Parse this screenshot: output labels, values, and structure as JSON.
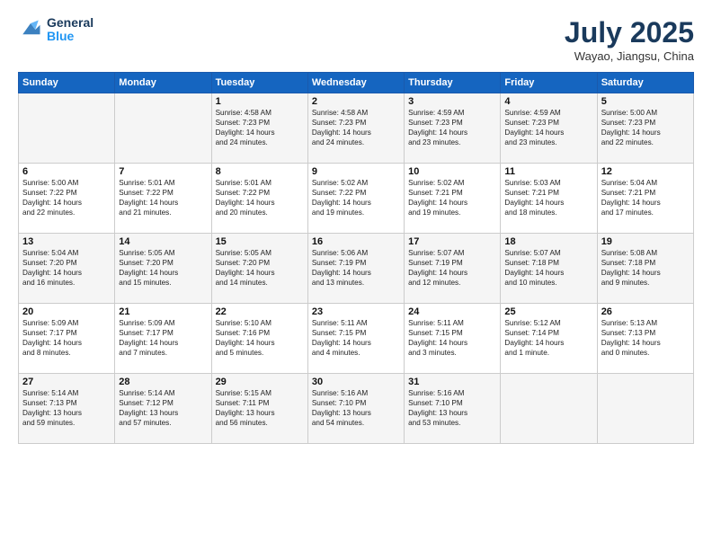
{
  "header": {
    "logo_line1": "General",
    "logo_line2": "Blue",
    "month": "July 2025",
    "location": "Wayao, Jiangsu, China"
  },
  "weekdays": [
    "Sunday",
    "Monday",
    "Tuesday",
    "Wednesday",
    "Thursday",
    "Friday",
    "Saturday"
  ],
  "weeks": [
    [
      {
        "day": "",
        "info": ""
      },
      {
        "day": "",
        "info": ""
      },
      {
        "day": "1",
        "info": "Sunrise: 4:58 AM\nSunset: 7:23 PM\nDaylight: 14 hours\nand 24 minutes."
      },
      {
        "day": "2",
        "info": "Sunrise: 4:58 AM\nSunset: 7:23 PM\nDaylight: 14 hours\nand 24 minutes."
      },
      {
        "day": "3",
        "info": "Sunrise: 4:59 AM\nSunset: 7:23 PM\nDaylight: 14 hours\nand 23 minutes."
      },
      {
        "day": "4",
        "info": "Sunrise: 4:59 AM\nSunset: 7:23 PM\nDaylight: 14 hours\nand 23 minutes."
      },
      {
        "day": "5",
        "info": "Sunrise: 5:00 AM\nSunset: 7:23 PM\nDaylight: 14 hours\nand 22 minutes."
      }
    ],
    [
      {
        "day": "6",
        "info": "Sunrise: 5:00 AM\nSunset: 7:22 PM\nDaylight: 14 hours\nand 22 minutes."
      },
      {
        "day": "7",
        "info": "Sunrise: 5:01 AM\nSunset: 7:22 PM\nDaylight: 14 hours\nand 21 minutes."
      },
      {
        "day": "8",
        "info": "Sunrise: 5:01 AM\nSunset: 7:22 PM\nDaylight: 14 hours\nand 20 minutes."
      },
      {
        "day": "9",
        "info": "Sunrise: 5:02 AM\nSunset: 7:22 PM\nDaylight: 14 hours\nand 19 minutes."
      },
      {
        "day": "10",
        "info": "Sunrise: 5:02 AM\nSunset: 7:21 PM\nDaylight: 14 hours\nand 19 minutes."
      },
      {
        "day": "11",
        "info": "Sunrise: 5:03 AM\nSunset: 7:21 PM\nDaylight: 14 hours\nand 18 minutes."
      },
      {
        "day": "12",
        "info": "Sunrise: 5:04 AM\nSunset: 7:21 PM\nDaylight: 14 hours\nand 17 minutes."
      }
    ],
    [
      {
        "day": "13",
        "info": "Sunrise: 5:04 AM\nSunset: 7:20 PM\nDaylight: 14 hours\nand 16 minutes."
      },
      {
        "day": "14",
        "info": "Sunrise: 5:05 AM\nSunset: 7:20 PM\nDaylight: 14 hours\nand 15 minutes."
      },
      {
        "day": "15",
        "info": "Sunrise: 5:05 AM\nSunset: 7:20 PM\nDaylight: 14 hours\nand 14 minutes."
      },
      {
        "day": "16",
        "info": "Sunrise: 5:06 AM\nSunset: 7:19 PM\nDaylight: 14 hours\nand 13 minutes."
      },
      {
        "day": "17",
        "info": "Sunrise: 5:07 AM\nSunset: 7:19 PM\nDaylight: 14 hours\nand 12 minutes."
      },
      {
        "day": "18",
        "info": "Sunrise: 5:07 AM\nSunset: 7:18 PM\nDaylight: 14 hours\nand 10 minutes."
      },
      {
        "day": "19",
        "info": "Sunrise: 5:08 AM\nSunset: 7:18 PM\nDaylight: 14 hours\nand 9 minutes."
      }
    ],
    [
      {
        "day": "20",
        "info": "Sunrise: 5:09 AM\nSunset: 7:17 PM\nDaylight: 14 hours\nand 8 minutes."
      },
      {
        "day": "21",
        "info": "Sunrise: 5:09 AM\nSunset: 7:17 PM\nDaylight: 14 hours\nand 7 minutes."
      },
      {
        "day": "22",
        "info": "Sunrise: 5:10 AM\nSunset: 7:16 PM\nDaylight: 14 hours\nand 5 minutes."
      },
      {
        "day": "23",
        "info": "Sunrise: 5:11 AM\nSunset: 7:15 PM\nDaylight: 14 hours\nand 4 minutes."
      },
      {
        "day": "24",
        "info": "Sunrise: 5:11 AM\nSunset: 7:15 PM\nDaylight: 14 hours\nand 3 minutes."
      },
      {
        "day": "25",
        "info": "Sunrise: 5:12 AM\nSunset: 7:14 PM\nDaylight: 14 hours\nand 1 minute."
      },
      {
        "day": "26",
        "info": "Sunrise: 5:13 AM\nSunset: 7:13 PM\nDaylight: 14 hours\nand 0 minutes."
      }
    ],
    [
      {
        "day": "27",
        "info": "Sunrise: 5:14 AM\nSunset: 7:13 PM\nDaylight: 13 hours\nand 59 minutes."
      },
      {
        "day": "28",
        "info": "Sunrise: 5:14 AM\nSunset: 7:12 PM\nDaylight: 13 hours\nand 57 minutes."
      },
      {
        "day": "29",
        "info": "Sunrise: 5:15 AM\nSunset: 7:11 PM\nDaylight: 13 hours\nand 56 minutes."
      },
      {
        "day": "30",
        "info": "Sunrise: 5:16 AM\nSunset: 7:10 PM\nDaylight: 13 hours\nand 54 minutes."
      },
      {
        "day": "31",
        "info": "Sunrise: 5:16 AM\nSunset: 7:10 PM\nDaylight: 13 hours\nand 53 minutes."
      },
      {
        "day": "",
        "info": ""
      },
      {
        "day": "",
        "info": ""
      }
    ]
  ]
}
